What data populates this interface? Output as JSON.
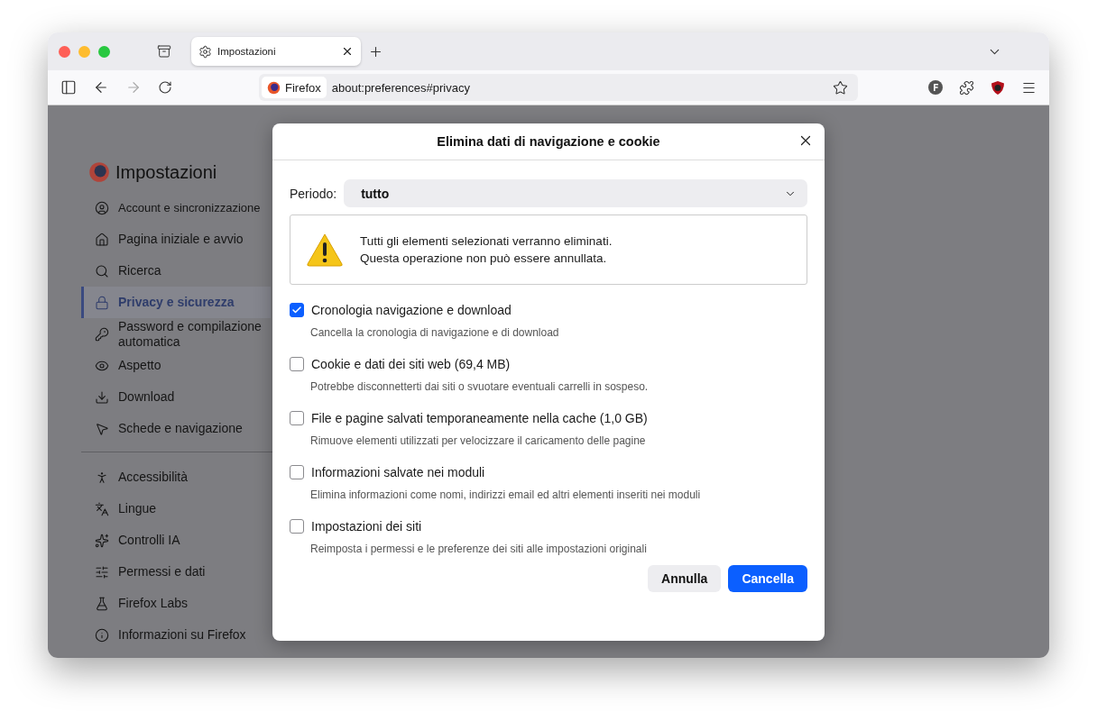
{
  "tab": {
    "title": "Impostazioni",
    "selected": true
  },
  "toolbar": {
    "identity": "Firefox",
    "url": "about:preferences#privacy"
  },
  "sidebar": {
    "title": "Impostazioni",
    "groups": [
      [
        {
          "label": "Account e sincronizzazione",
          "selected": false
        },
        {
          "label": "Pagina iniziale e avvio",
          "selected": false
        },
        {
          "label": "Ricerca",
          "selected": false
        },
        {
          "label": "Privacy e sicurezza",
          "selected": true
        },
        {
          "label": "Password e compilazione automatica",
          "selected": false
        },
        {
          "label": "Aspetto",
          "selected": false
        },
        {
          "label": "Download",
          "selected": false
        },
        {
          "label": "Schede e navigazione",
          "selected": false
        }
      ],
      [
        {
          "label": "Accessibilità",
          "selected": false
        },
        {
          "label": "Lingue",
          "selected": false
        },
        {
          "label": "Controlli IA",
          "selected": false
        },
        {
          "label": "Permessi e dati",
          "selected": false
        },
        {
          "label": "Firefox Labs",
          "selected": false
        },
        {
          "label": "Informazioni su Firefox",
          "selected": false
        }
      ]
    ]
  },
  "dialog": {
    "title": "Elimina dati di navigazione e cookie",
    "period_label": "Periodo:",
    "period_value": "tutto",
    "warning": [
      "Tutti gli elementi selezionati verranno eliminati.",
      "Questa operazione non può essere annullata."
    ],
    "options": [
      {
        "label": "Cronologia navigazione e download",
        "description": "Cancella la cronologia di navigazione e di download",
        "checked": true
      },
      {
        "label": "Cookie e dati dei siti web (69,4 MB)",
        "description": "Potrebbe disconnetterti dai siti o svuotare eventuali carrelli in sospeso.",
        "checked": false
      },
      {
        "label": "File e pagine salvati temporaneamente nella cache (1,0 GB)",
        "description": "Rimuove elementi utilizzati per velocizzare il caricamento delle pagine",
        "checked": false
      },
      {
        "label": "Informazioni salvate nei moduli",
        "description": "Elimina informazioni come nomi, indirizzi email ed altri elementi inseriti nei moduli",
        "checked": false
      },
      {
        "label": "Impostazioni dei siti",
        "description": "Reimposta i permessi e le preferenze dei siti alle impostazioni originali",
        "checked": false
      }
    ],
    "buttons": [
      {
        "label": "Annulla",
        "kind": "secondary"
      },
      {
        "label": "Cancella",
        "kind": "primary"
      }
    ]
  }
}
